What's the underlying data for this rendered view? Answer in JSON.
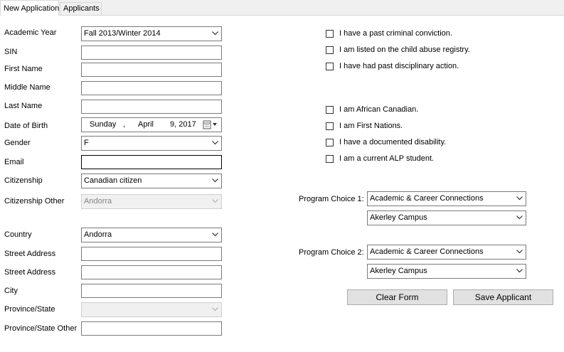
{
  "tabs": [
    "New Application",
    "Applicants"
  ],
  "form": {
    "academic_year_label": "Academic Year",
    "academic_year_value": "Fall 2013/Winter 2014",
    "sin_label": "SIN",
    "sin_value": "",
    "first_name_label": "First Name",
    "first_name_value": "",
    "middle_name_label": "Middle Name",
    "middle_name_value": "",
    "last_name_label": "Last Name",
    "last_name_value": "",
    "dob_label": "Date of Birth",
    "dob_weekday": "Sunday",
    "dob_sep": ",",
    "dob_month": "April",
    "dob_day_year": "9, 2017",
    "gender_label": "Gender",
    "gender_value": "F",
    "email_label": "Email",
    "email_value": "",
    "citizenship_label": "Citizenship",
    "citizenship_value": "Canadian citizen",
    "citizenship_other_label": "Citizenship Other",
    "citizenship_other_value": "Andorra",
    "country_label": "Country",
    "country_value": "Andorra",
    "street1_label": "Street Address",
    "street1_value": "",
    "street2_label": "Street Address",
    "street2_value": "",
    "city_label": "City",
    "city_value": "",
    "province_label": "Province/State",
    "province_value": "",
    "province_other_label": "Province/State Other",
    "province_other_value": ""
  },
  "checks_top": [
    {
      "label": "I have a past criminal conviction.",
      "checked": false
    },
    {
      "label": "I am listed on the child abuse registry.",
      "checked": false
    },
    {
      "label": "I have had past disciplinary action.",
      "checked": false
    }
  ],
  "checks_bottom": [
    {
      "label": "I am African Canadian.",
      "checked": false
    },
    {
      "label": "I am First Nations.",
      "checked": false
    },
    {
      "label": "I have a documented disability.",
      "checked": false
    },
    {
      "label": "I am a current ALP student.",
      "checked": false
    }
  ],
  "program1": {
    "label": "Program Choice 1:",
    "program": "Academic & Career Connections",
    "campus": "Akerley Campus"
  },
  "program2": {
    "label": "Program Choice 2:",
    "program": "Academic & Career Connections",
    "campus": "Akerley Campus"
  },
  "buttons": {
    "clear": "Clear Form",
    "save": "Save Applicant"
  },
  "icons": {
    "dropdown": "chevron-down-icon",
    "calendar": "calendar-icon"
  }
}
